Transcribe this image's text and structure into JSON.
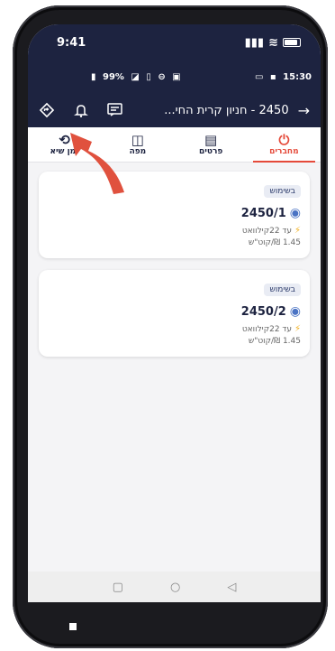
{
  "ios_status": {
    "time": "9:41"
  },
  "android_status": {
    "battery": "99%",
    "clock": "15:30"
  },
  "appbar": {
    "title": "2450 - חניון קרית החי..."
  },
  "tabs": [
    {
      "label": "מחברים"
    },
    {
      "label": "פרטים"
    },
    {
      "label": "מפה"
    },
    {
      "label": "זמן שיא"
    }
  ],
  "connectors": [
    {
      "status": "בשימוש",
      "name": "2450/1",
      "power": "עד 22קילוואט",
      "price": "1.45 ₪/קוט\"ש"
    },
    {
      "status": "בשימוש",
      "name": "2450/2",
      "power": "עד 22קילוואט",
      "price": "1.45 ₪/קוט\"ש"
    }
  ],
  "colors": {
    "header": "#1d2340",
    "accent": "#e54a3a",
    "annotation_arrow": "#e0513e"
  }
}
